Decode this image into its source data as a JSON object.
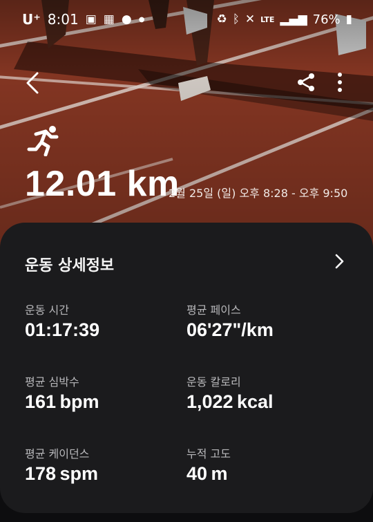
{
  "status_bar": {
    "carrier": "U⁺",
    "time": "8:01",
    "network": "LTE",
    "battery": "76%"
  },
  "header": {
    "distance": "12.01 km",
    "time_range": "2월 25일 (일) 오후 8:28 - 오후 9:50"
  },
  "details": {
    "title": "운동 상세정보",
    "stats": [
      {
        "label": "운동 시간",
        "value": "01:17:39",
        "unit": ""
      },
      {
        "label": "평균 페이스",
        "value": "06'27\"",
        "unit": "/km"
      },
      {
        "label": "평균 심박수",
        "value": "161",
        "unit": "bpm"
      },
      {
        "label": "운동 칼로리",
        "value": "1,022",
        "unit": "kcal"
      },
      {
        "label": "평균 케이던스",
        "value": "178",
        "unit": "spm"
      },
      {
        "label": "누적 고도",
        "value": "40",
        "unit": "m"
      }
    ]
  },
  "colors": {
    "track": "#8e3a25",
    "card_background": "#1b1b1d",
    "label_gray": "#b9b9bc"
  },
  "icons": [
    "back-arrow-icon",
    "share-icon",
    "more-vert-icon",
    "running-icon",
    "chevron-right-icon"
  ]
}
